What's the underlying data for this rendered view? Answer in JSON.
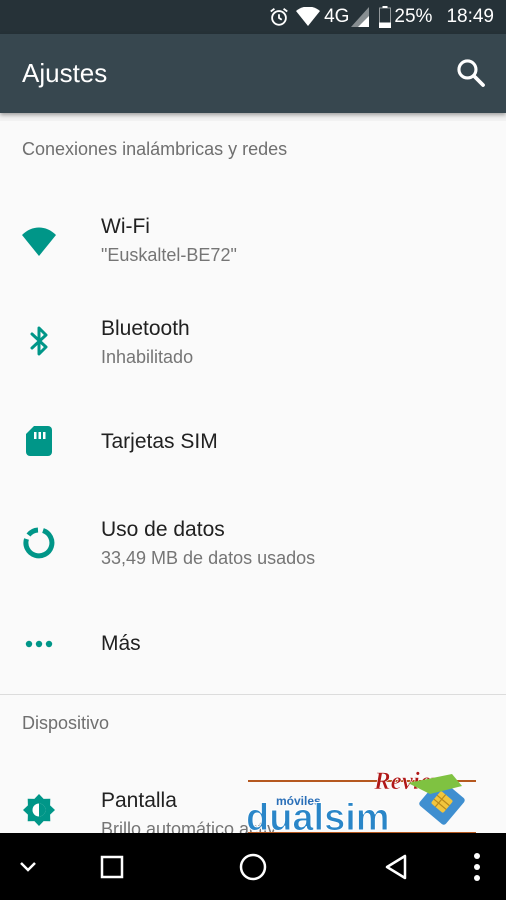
{
  "status_bar": {
    "network": "4G",
    "battery": "25%",
    "time": "18:49",
    "icons": [
      "alarm-icon",
      "wifi-signal-icon",
      "cell-signal-icon",
      "battery-icon"
    ]
  },
  "app_bar": {
    "title": "Ajustes",
    "search_icon": "search-icon"
  },
  "sections": {
    "wireless": {
      "header": "Conexiones inalámbricas y redes",
      "items": [
        {
          "title": "Wi-Fi",
          "subtitle": "\"Euskaltel-BE72\"",
          "icon": "wifi-icon"
        },
        {
          "title": "Bluetooth",
          "subtitle": "Inhabilitado",
          "icon": "bluetooth-icon"
        },
        {
          "title": "Tarjetas SIM",
          "icon": "sim-card-icon"
        },
        {
          "title": "Uso de datos",
          "subtitle": "33,49 MB de datos usados",
          "icon": "data-usage-icon"
        },
        {
          "title": "Más",
          "icon": "more-icon"
        }
      ]
    },
    "device": {
      "header": "Dispositivo",
      "items": [
        {
          "title": "Pantalla",
          "subtitle": "Brillo automático activ",
          "icon": "brightness-icon"
        }
      ]
    }
  },
  "watermark": {
    "small": "móviles",
    "brand": "dualsim",
    "tag": "Review"
  },
  "nav_bar": {
    "icons": [
      "chevron-down-icon",
      "recents-icon",
      "home-icon",
      "back-icon",
      "menu-icon"
    ]
  },
  "colors": {
    "accent": "#009688",
    "app_bar": "#37474f",
    "status_bar": "#263238"
  }
}
